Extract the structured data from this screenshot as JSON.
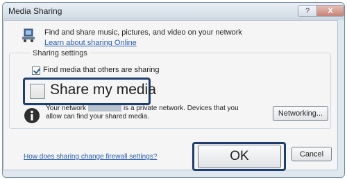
{
  "window": {
    "title": "Media Sharing",
    "help_glyph": "?",
    "close_glyph": "X"
  },
  "header": {
    "icon": "media-sharing-icon",
    "description": "Find and share music, pictures, and video on your network",
    "learn_link": "Learn about sharing Online"
  },
  "sharing_settings": {
    "group_label": "Sharing settings",
    "find_media_label": "Find media that others are sharing",
    "find_media_checked": true,
    "share_my_media_label": "Share my media",
    "share_my_media_checked": false
  },
  "network": {
    "icon": "info-icon",
    "text_before": "Your network",
    "text_after": "is a private network. Devices that you allow can find your shared media.",
    "networking_button": "Networking..."
  },
  "footer": {
    "firewall_link": "How does sharing change firewall settings?",
    "ok_button": "OK",
    "cancel_button": "Cancel"
  },
  "colors": {
    "highlight_border": "#1e3d70",
    "link": "#2a5db0"
  }
}
